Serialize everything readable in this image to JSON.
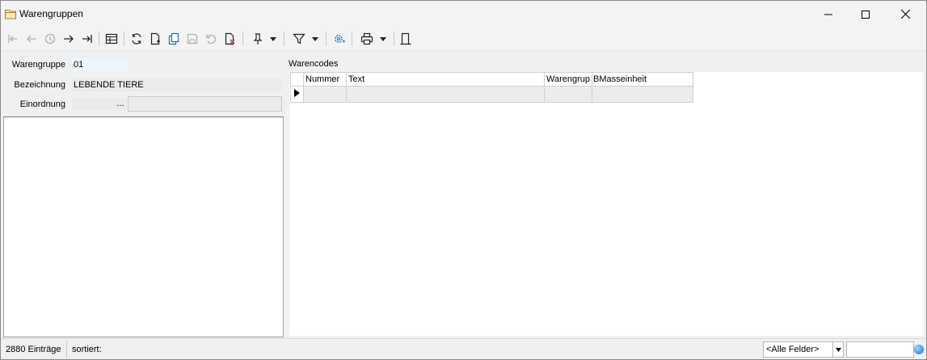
{
  "window": {
    "title": "Warengruppen"
  },
  "toolbar": {
    "items": [
      {
        "name": "first-record-icon"
      },
      {
        "name": "previous-record-icon"
      },
      {
        "name": "history-icon"
      },
      {
        "name": "next-record-icon"
      },
      {
        "name": "last-record-icon"
      },
      {
        "name": "table-view-icon"
      },
      {
        "name": "refresh-icon"
      },
      {
        "name": "new-document-icon"
      },
      {
        "name": "copy-icon"
      },
      {
        "name": "save-icon"
      },
      {
        "name": "undo-icon"
      },
      {
        "name": "delete-icon"
      },
      {
        "name": "pin-icon"
      },
      {
        "name": "filter-icon"
      },
      {
        "name": "settings-icon"
      },
      {
        "name": "print-icon"
      },
      {
        "name": "exit-icon"
      }
    ]
  },
  "form": {
    "warengruppe_label": "Warengruppe",
    "warengruppe_value": "01",
    "bezeichnung_label": "Bezeichnung",
    "bezeichnung_value": "LEBENDE TIERE",
    "einordnung_label": "Einordnung",
    "einordnung_button": "...",
    "einordnung_value": ""
  },
  "warencodes": {
    "title": "Warencodes",
    "columns": [
      "Nummer",
      "Text",
      "Warengrup",
      "BMasseinheit"
    ],
    "rows": [
      [
        "",
        "",
        "",
        ""
      ]
    ]
  },
  "status": {
    "count": "2880 Einträge",
    "sorted": "sortiert:",
    "field_selector": "<Alle Felder>",
    "search_value": ""
  }
}
